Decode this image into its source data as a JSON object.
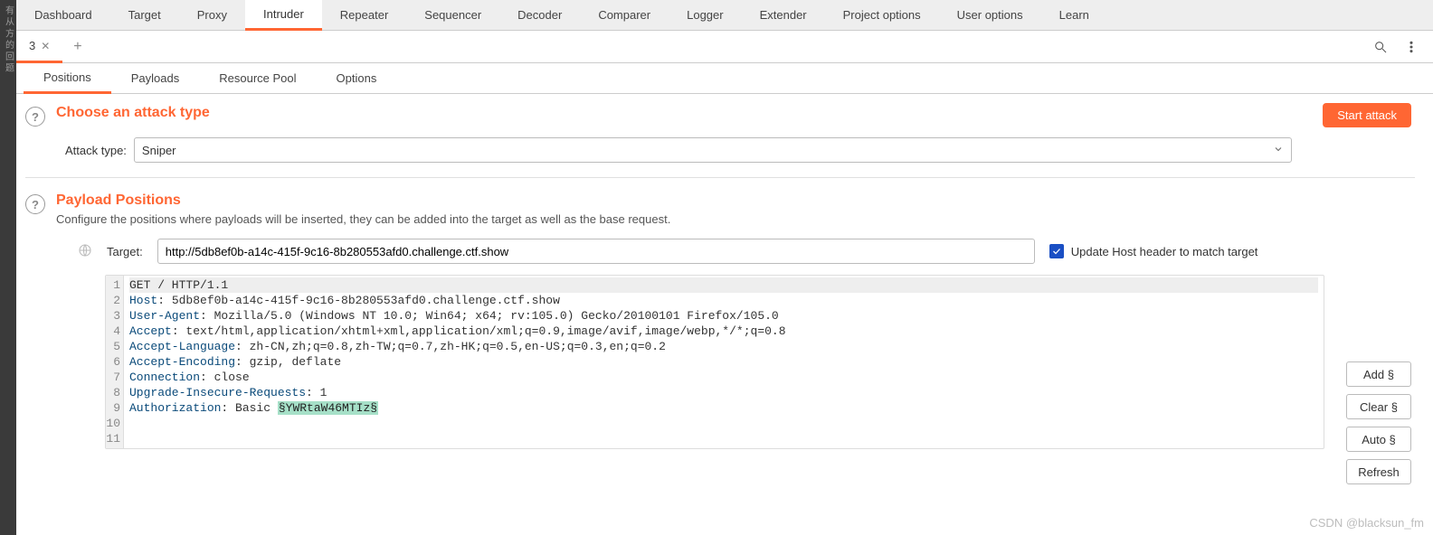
{
  "left_edge_chars": "有 从 方 的 回 题",
  "main_tabs": [
    "Dashboard",
    "Target",
    "Proxy",
    "Intruder",
    "Repeater",
    "Sequencer",
    "Decoder",
    "Comparer",
    "Logger",
    "Extender",
    "Project options",
    "User options",
    "Learn"
  ],
  "main_tab_active": "Intruder",
  "sub_tabs": {
    "active": "3",
    "add_glyph": "+"
  },
  "inner_tabs": [
    "Positions",
    "Payloads",
    "Resource Pool",
    "Options"
  ],
  "inner_tab_active": "Positions",
  "attack_section": {
    "title": "Choose an attack type",
    "label": "Attack type:",
    "selected": "Sniper",
    "start_button": "Start attack"
  },
  "positions_section": {
    "title": "Payload Positions",
    "desc": "Configure the positions where payloads will be inserted, they can be added into the target as well as the base request."
  },
  "target_row": {
    "label": "Target:",
    "value": "http://5db8ef0b-a14c-415f-9c16-8b280553afd0.challenge.ctf.show",
    "checkbox_label": "Update Host header to match target"
  },
  "side_buttons": [
    "Add §",
    "Clear §",
    "Auto §",
    "Refresh"
  ],
  "editor": {
    "lines": 11,
    "request_line": "GET / HTTP/1.1",
    "headers": [
      {
        "k": "Host",
        "v": " 5db8ef0b-a14c-415f-9c16-8b280553afd0.challenge.ctf.show"
      },
      {
        "k": "User-Agent",
        "v": " Mozilla/5.0 (Windows NT 10.0; Win64; x64; rv:105.0) Gecko/20100101 Firefox/105.0"
      },
      {
        "k": "Accept",
        "v": " text/html,application/xhtml+xml,application/xml;q=0.9,image/avif,image/webp,*/*;q=0.8"
      },
      {
        "k": "Accept-Language",
        "v": " zh-CN,zh;q=0.8,zh-TW;q=0.7,zh-HK;q=0.5,en-US;q=0.3,en;q=0.2"
      },
      {
        "k": "Accept-Encoding",
        "v": " gzip, deflate"
      },
      {
        "k": "Connection",
        "v": " close"
      },
      {
        "k": "Upgrade-Insecure-Requests",
        "v": " 1"
      }
    ],
    "auth": {
      "k": "Authorization",
      "prefix": " Basic ",
      "marker": "§YWRtaW46MTIz§"
    }
  },
  "watermark": "CSDN @blacksun_fm"
}
